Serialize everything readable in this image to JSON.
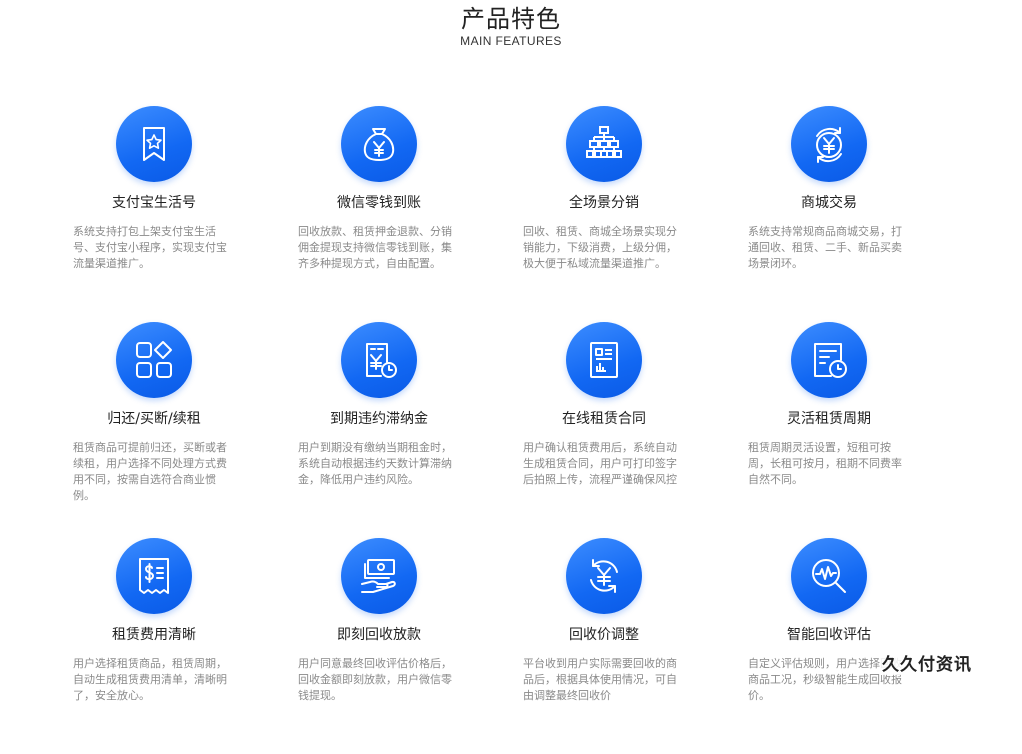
{
  "header": {
    "title": "产品特色",
    "subtitle": "MAIN FEATURES"
  },
  "features": [
    {
      "title": "支付宝生活号",
      "desc": "系统支持打包上架支付宝生活号、支付宝小程序，实现支付宝流量渠道推广。",
      "icon": "bookmark-star-icon"
    },
    {
      "title": "微信零钱到账",
      "desc": "回收放款、租赁押金退款、分销佣金提现支持微信零钱到账，集齐多种提现方式，自由配置。",
      "icon": "money-bag-icon"
    },
    {
      "title": "全场景分销",
      "desc": "回收、租赁、商城全场景实现分销能力，下级消费，上级分佣，极大便于私域流量渠道推广。",
      "icon": "org-chart-icon"
    },
    {
      "title": "商城交易",
      "desc": "系统支持常规商品商城交易，打通回收、租赁、二手、新品买卖场景闭环。",
      "icon": "yen-cycle-icon"
    },
    {
      "title": "归还/买断/续租",
      "desc": "租赁商品可提前归还，买断或者续租，用户选择不同处理方式费用不同，按需自选符合商业惯例。",
      "icon": "app-grid-icon"
    },
    {
      "title": "到期违约滞纳金",
      "desc": "用户到期没有缴纳当期租金时，系统自动根据违约天数计算滞纳金，降低用户违约风险。",
      "icon": "bill-clock-icon"
    },
    {
      "title": "在线租赁合同",
      "desc": "用户确认租赁费用后，系统自动生成租赁合同，用户可打印签字后拍照上传，流程严谨确保风控",
      "icon": "contract-icon"
    },
    {
      "title": "灵活租赁周期",
      "desc": "租赁周期灵活设置，短租可按周，长租可按月，租期不同费率自然不同。",
      "icon": "document-clock-icon"
    },
    {
      "title": "租赁费用清晰",
      "desc": "用户选择租赁商品，租赁周期，自动生成租赁费用清单，清晰明了，安全放心。",
      "icon": "receipt-dollar-icon"
    },
    {
      "title": "即刻回收放款",
      "desc": "用户同意最终回收评估价格后，回收金额即刻放款，用户微信零钱提现。",
      "icon": "cash-hand-icon"
    },
    {
      "title": "回收价调整",
      "desc": "平台收到用户实际需要回收的商品后，根据具体使用情况，可自由调整最终回收价",
      "icon": "yen-refresh-icon"
    },
    {
      "title": "智能回收评估",
      "desc": "自定义评估规则，用户选择回收商品工况，秒级智能生成回收报价。",
      "icon": "search-pulse-icon"
    }
  ],
  "watermark": "久久付资讯",
  "colors": {
    "icon_blue": "#1268f3",
    "title": "#222222",
    "desc": "#8a8a8a"
  }
}
